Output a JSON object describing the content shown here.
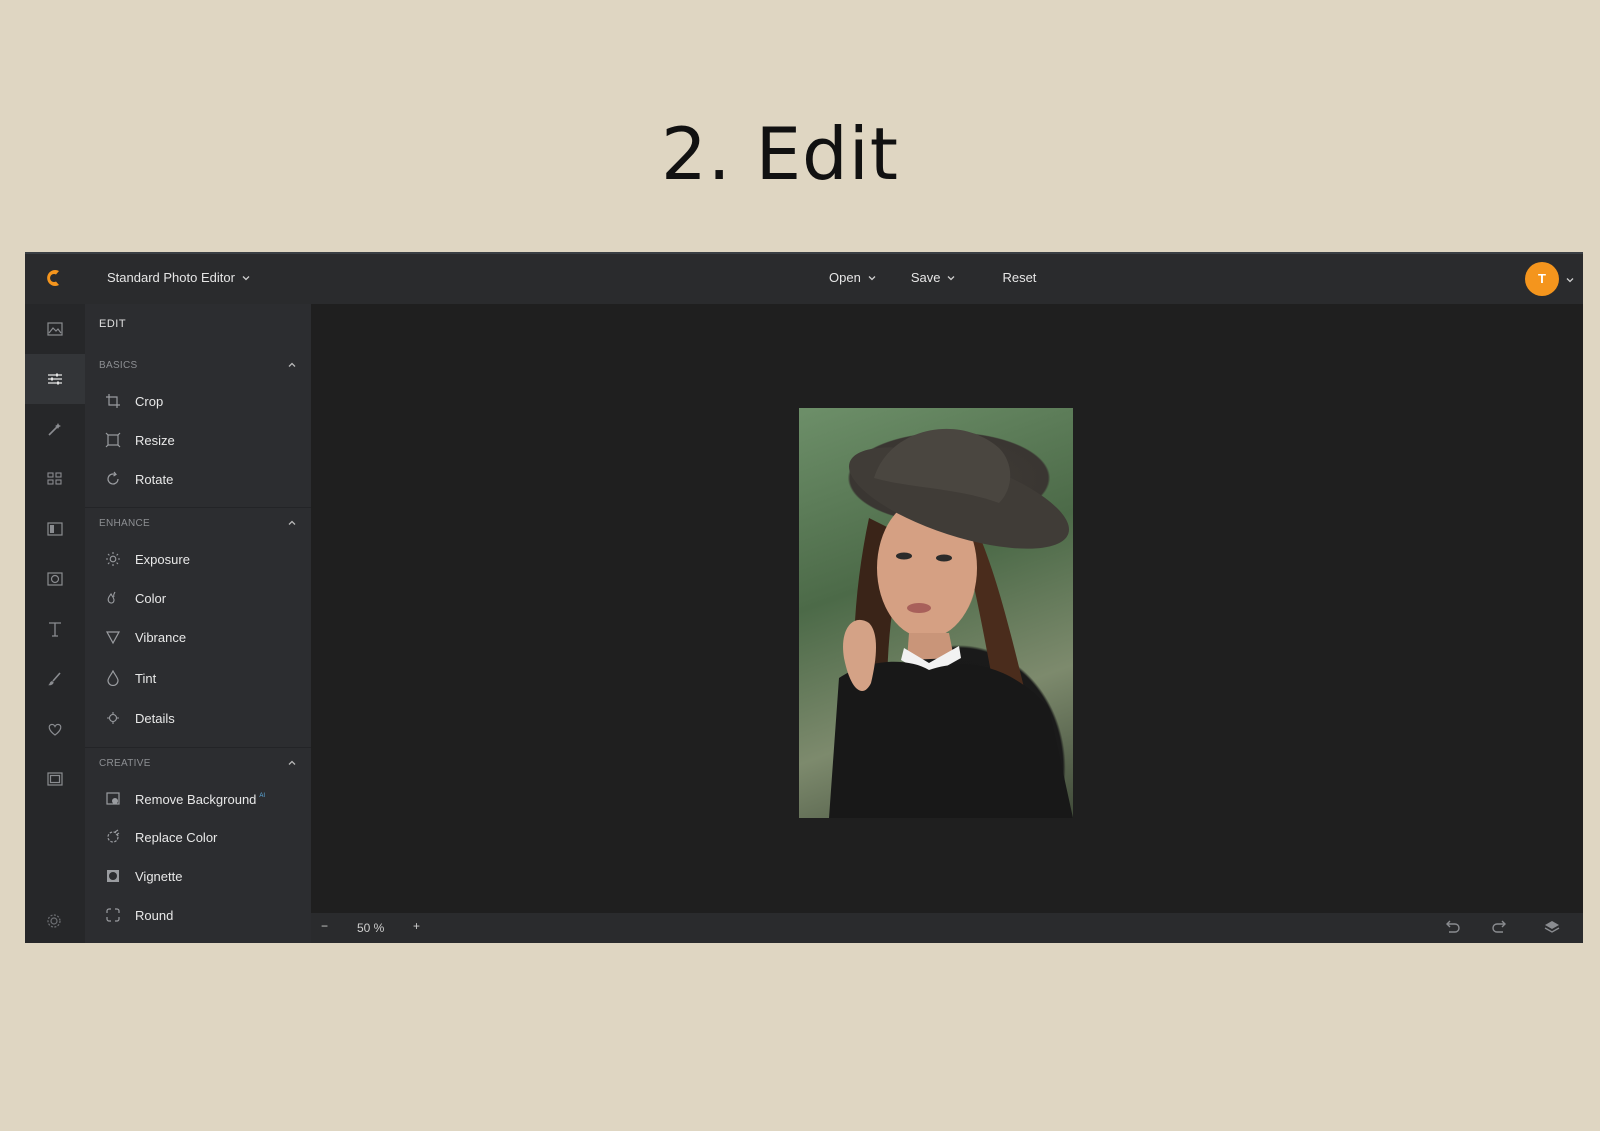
{
  "slide": {
    "title": "2. Edit"
  },
  "topbar": {
    "editor_mode": "Standard Photo Editor",
    "menu": {
      "open": "Open",
      "save": "Save",
      "reset": "Reset"
    },
    "avatar_initial": "T"
  },
  "rail": {
    "icons": [
      "image-icon",
      "sliders-icon",
      "magic-wand-icon",
      "grid-icon",
      "frame-icon",
      "overlay-icon",
      "text-icon",
      "brush-icon",
      "heart-icon",
      "border-icon",
      "gear-icon"
    ],
    "active": "sliders-icon"
  },
  "panel": {
    "title": "EDIT",
    "sections": {
      "basics": {
        "label": "BASICS",
        "items": [
          "Crop",
          "Resize",
          "Rotate"
        ]
      },
      "enhance": {
        "label": "ENHANCE",
        "items": [
          "Exposure",
          "Color",
          "Vibrance",
          "Tint",
          "Details"
        ]
      },
      "creative": {
        "label": "CREATIVE",
        "items": [
          "Remove Background",
          "Replace Color",
          "Vignette",
          "Round"
        ],
        "ai_badge": "AI"
      }
    }
  },
  "bottombar": {
    "zoom_minus": "−",
    "zoom": "50 %",
    "zoom_plus": "+"
  },
  "colors": {
    "accent": "#f4951d",
    "slide_bg": "#dfd6c2",
    "editor_bg": "#1e1e1e"
  }
}
